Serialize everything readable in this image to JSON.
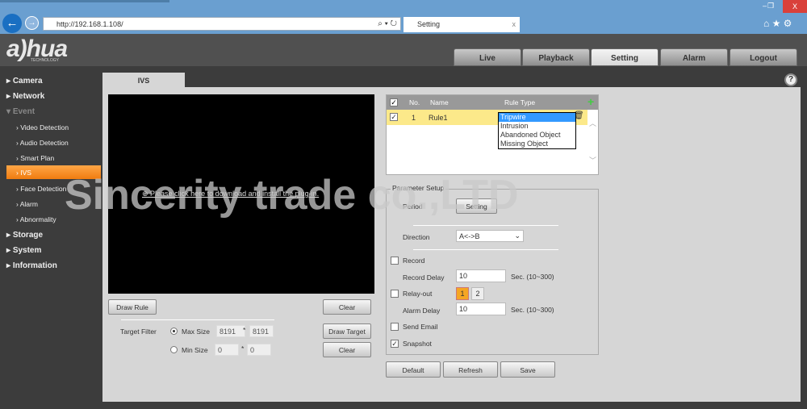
{
  "browser": {
    "url": "http://192.168.1.108/",
    "tab_title": "Setting",
    "tab_close": "x",
    "min": "–",
    "max": "❐",
    "close": "X"
  },
  "header": {
    "logo": "a)hua",
    "logo_sub": "TECHNOLOGY",
    "tabs": [
      "Live",
      "Playback",
      "Setting",
      "Alarm",
      "Logout"
    ],
    "active_tab": "Setting"
  },
  "sidebar": {
    "camera": "Camera",
    "network": "Network",
    "event": "Event",
    "event_items": [
      "Video Detection",
      "Audio Detection",
      "Smart Plan",
      "IVS",
      "Face Detection",
      "Alarm",
      "Abnormality"
    ],
    "storage": "Storage",
    "system": "System",
    "information": "Information",
    "active": "IVS"
  },
  "page": {
    "tab": "IVS",
    "help": "?",
    "plugin_msg": "Please click here to download and install the plug-in.",
    "draw_rule": "Draw Rule",
    "clear": "Clear",
    "target_filter": "Target Filter",
    "max_size": "Max Size",
    "max_w": "8191",
    "max_h": "8191",
    "min_size": "Min Size",
    "min_w": "0",
    "min_h": "0",
    "times": "*",
    "draw_target": "Draw Target",
    "clear2": "Clear"
  },
  "rules": {
    "headers": {
      "no": "No.",
      "name": "Name",
      "type": "Rule Type"
    },
    "rows": [
      {
        "checked": true,
        "no": "1",
        "name": "Rule1"
      }
    ],
    "dropdown_options": [
      "Tripwire",
      "Intrusion",
      "Abandoned Object",
      "Missing Object"
    ],
    "selected": "Tripwire"
  },
  "params": {
    "legend": "Parameter Setup",
    "period": "Period",
    "setting": "Setting",
    "direction": "Direction",
    "direction_value": "A<->B",
    "record": "Record",
    "record_checked": false,
    "record_delay": "Record Delay",
    "record_delay_value": "10",
    "range": "Sec. (10~300)",
    "relay_out": "Relay-out",
    "relay_checked": false,
    "relay1": "1",
    "relay2": "2",
    "alarm_delay": "Alarm Delay",
    "alarm_delay_value": "10",
    "range2": "Sec. (10~300)",
    "send_email": "Send Email",
    "email_checked": false,
    "snapshot": "Snapshot",
    "snapshot_checked": true
  },
  "actions": {
    "default": "Default",
    "refresh": "Refresh",
    "save": "Save"
  },
  "watermark": "Sincerity trade co.,LTD",
  "colors": {
    "accent": "#f5891f",
    "selected_row": "#fce98a",
    "dropdown_highlight": "#3399ff"
  }
}
